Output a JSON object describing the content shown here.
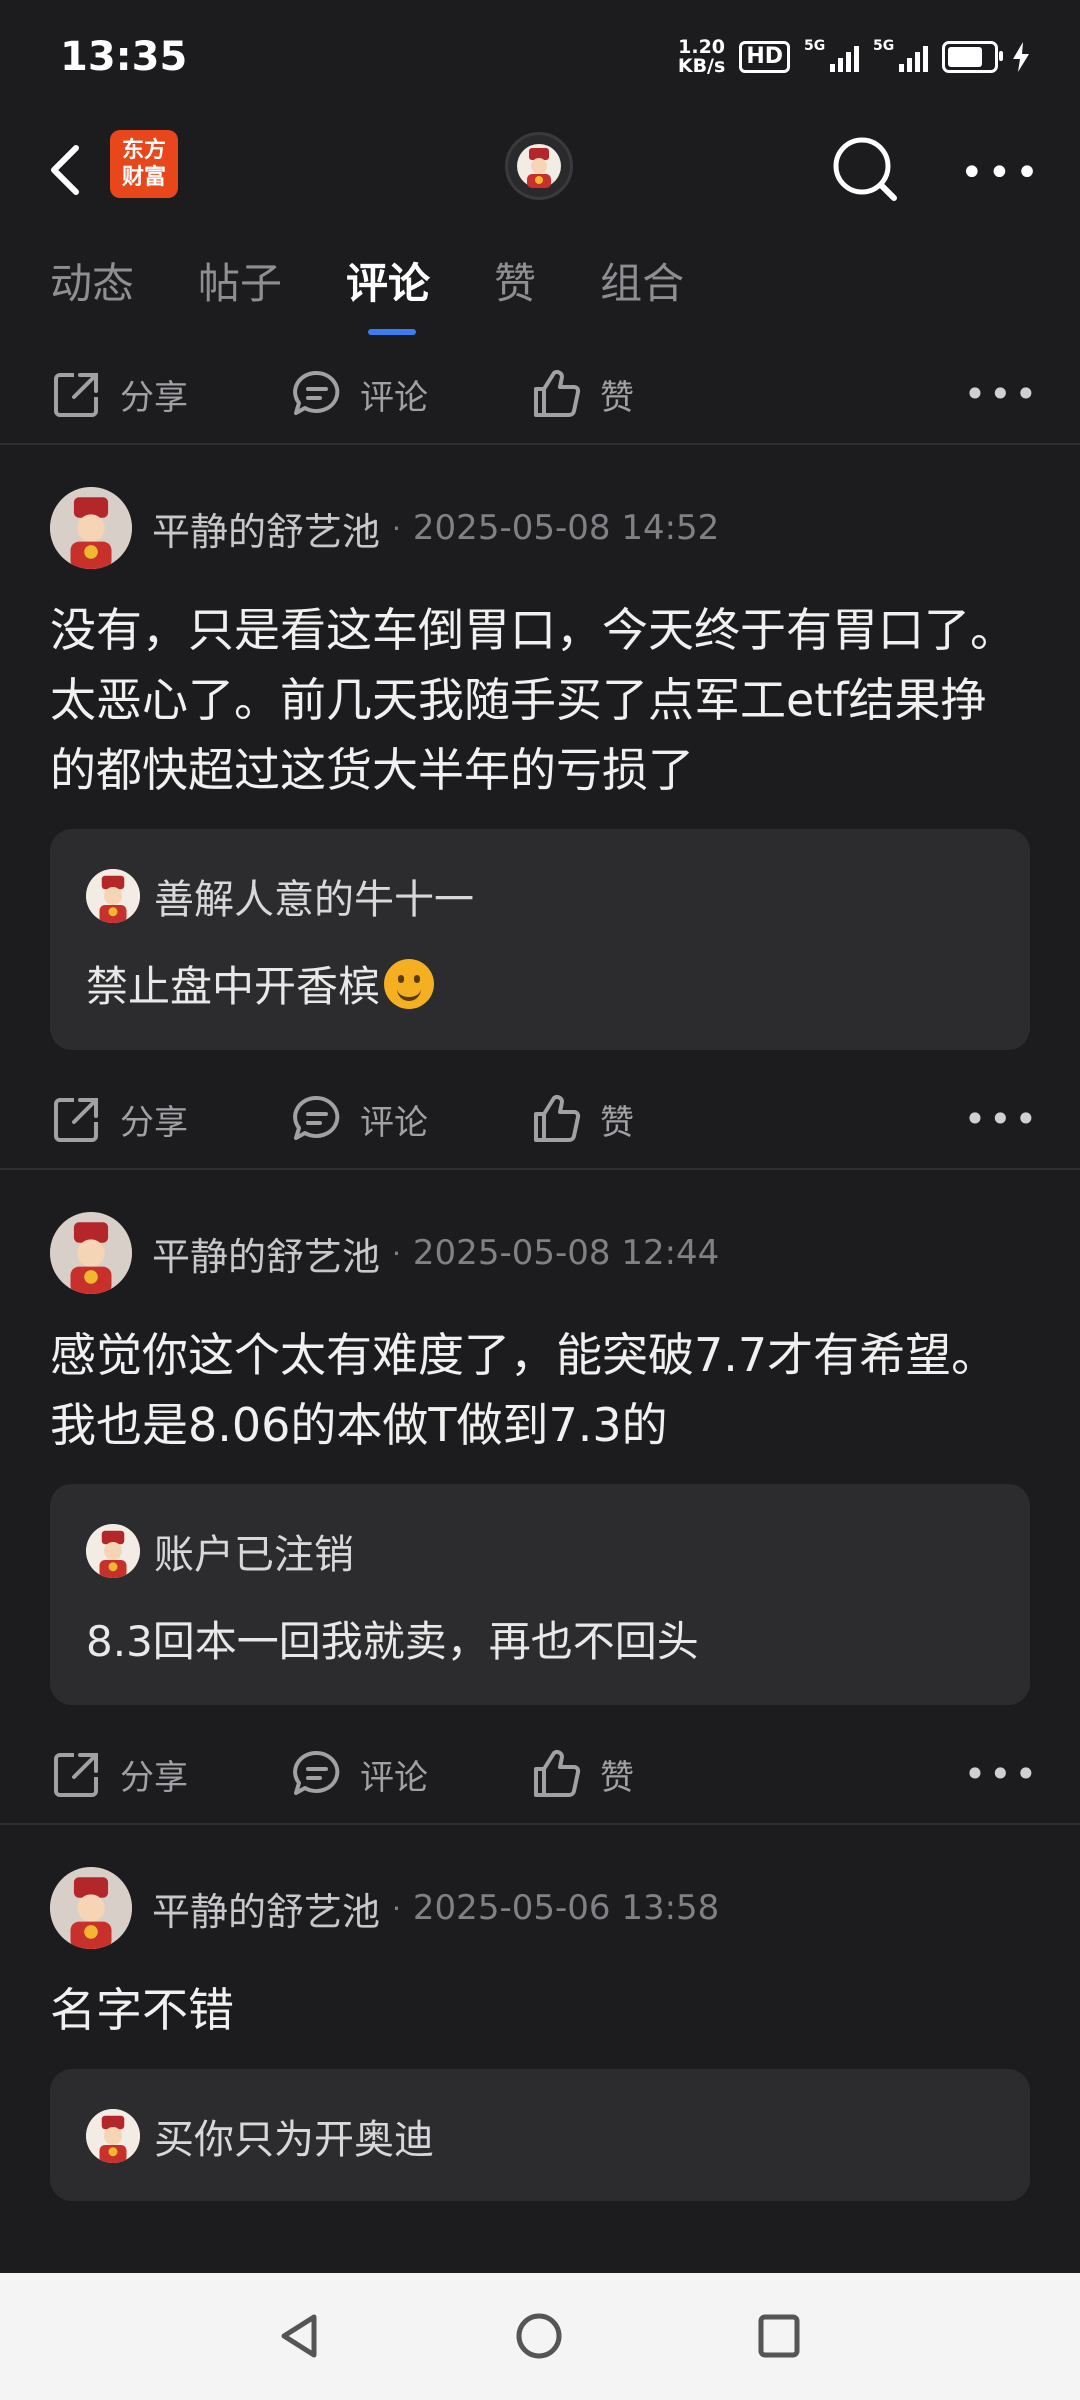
{
  "status": {
    "time": "13:35",
    "net_speed_value": "1.20",
    "net_speed_unit": "KB/s",
    "hd_label": "HD",
    "sim1": "5G",
    "sim2": "5G"
  },
  "header": {
    "logo_line1": "东方",
    "logo_line2": "财富"
  },
  "tabs": [
    {
      "label": "动态",
      "active": false
    },
    {
      "label": "帖子",
      "active": false
    },
    {
      "label": "评论",
      "active": true
    },
    {
      "label": "赞",
      "active": false
    },
    {
      "label": "组合",
      "active": false
    }
  ],
  "actions": {
    "share": "分享",
    "comment": "评论",
    "like": "赞"
  },
  "posts": [
    {
      "user": "平静的舒艺池",
      "date": "2025-05-08 14:52",
      "text": "没有，只是看这车倒胃口，今天终于有胃口了。太恶心了。前几天我随手买了点军工etf结果挣的都快超过这货大半年的亏损了",
      "quote_user": "善解人意的牛十一",
      "quote_text": "禁止盘中开香槟"
    },
    {
      "user": "平静的舒艺池",
      "date": "2025-05-08 12:44",
      "text": "感觉你这个太有难度了，能突破7.7才有希望。我也是8.06的本做T做到7.3的",
      "quote_user": "账户已注销",
      "quote_text": "8.3回本一回我就卖，再也不回头"
    },
    {
      "user": "平静的舒艺池",
      "date": "2025-05-06 13:58",
      "text": "名字不错",
      "quote_user": "买你只为开奥迪",
      "quote_text": ""
    }
  ]
}
